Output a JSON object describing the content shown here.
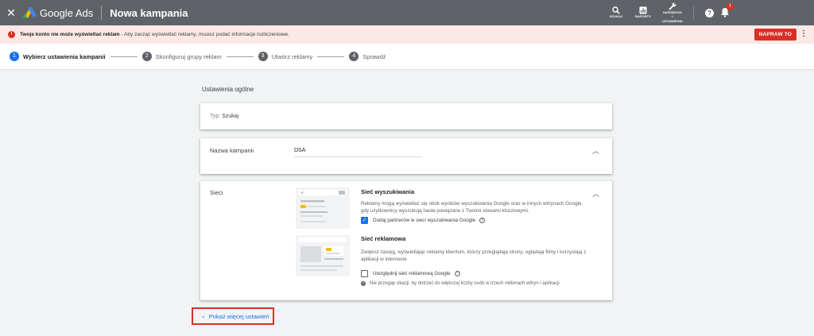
{
  "topbar": {
    "close_icon": "close-icon",
    "brand": "Google Ads",
    "title": "Nowa kampania",
    "tools": {
      "search": "SZUKAJ",
      "reports": "RAPORTY",
      "tools_line1": "NARZĘDZIA",
      "tools_line2": "I",
      "tools_line3": "USTAWIENIA"
    },
    "notifications_badge": "!"
  },
  "banner": {
    "bold": "Twoje konto nie może wyświetlać reklam",
    "rest": " - Aby zacząć wyświetlać reklamy, musisz podać informacje rozliczeniowe.",
    "fix_button": "NAPRAW TO"
  },
  "steps": [
    {
      "num": "1",
      "label": "Wybierz ustawienia kampanii"
    },
    {
      "num": "2",
      "label": "Skonfiguruj grupy reklam"
    },
    {
      "num": "3",
      "label": "Utwórz reklamy"
    },
    {
      "num": "4",
      "label": "Sprawdź"
    }
  ],
  "main": {
    "heading": "Ustawienia ogólne",
    "type_label": "Typ:",
    "type_value": "Szukaj",
    "campaign_name_label": "Nazwa kampanii",
    "campaign_name_value": "DSA",
    "networks_label": "Sieci",
    "search_network": {
      "title": "Sieć wyszukiwania",
      "desc": "Reklamy mogą wyświetlać się obok wyników wyszukiwania Google oraz w innych witrynach Google, gdy użytkownicy wyszukują hasła powiązane z Twoimi słowami kluczowymi.",
      "checkbox": "Dodaj partnerów w sieci wyszukiwania Google",
      "checked": true
    },
    "display_network": {
      "title": "Sieć reklamowa",
      "desc": "Zwiększ zasięg, wyświetlając reklamy klientom, którzy przeglądają strony, oglądają filmy i korzystają z aplikacji w internecie",
      "checkbox": "Uwzględnij sieć reklamową Google",
      "checked": false,
      "tip": "Nie przegap okazji, by dotrzeć do większej liczby osób w trzech milionach witryn i aplikacji"
    },
    "more_settings": "Pokaż więcej ustawień"
  },
  "colors": {
    "topbar": "#5f6368",
    "banner_bg": "#fce8e6",
    "accent_red": "#d93025",
    "accent_blue": "#1a73e8"
  }
}
